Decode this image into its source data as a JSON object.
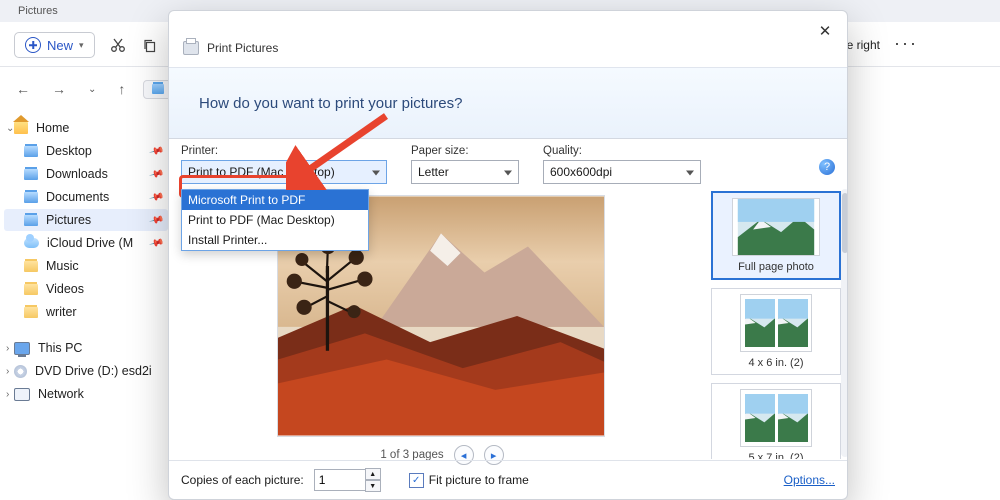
{
  "explorer": {
    "window_title": "Pictures",
    "new_label": "New",
    "right_hint": "e right",
    "address_crumb": "",
    "sidebar": [
      {
        "label": "Home",
        "kind": "home",
        "lv": 0,
        "caret": "v"
      },
      {
        "label": "Desktop",
        "kind": "bluefld",
        "lv": 1,
        "pin": true
      },
      {
        "label": "Downloads",
        "kind": "bluefld",
        "lv": 1,
        "pin": true
      },
      {
        "label": "Documents",
        "kind": "bluefld",
        "lv": 1,
        "pin": true
      },
      {
        "label": "Pictures",
        "kind": "bluefld",
        "lv": 1,
        "pin": true,
        "selected": true
      },
      {
        "label": "iCloud Drive (M",
        "kind": "cloud",
        "lv": 1,
        "pin": true
      },
      {
        "label": "Music",
        "kind": "fld",
        "lv": 1
      },
      {
        "label": "Videos",
        "kind": "fld",
        "lv": 1
      },
      {
        "label": "writer",
        "kind": "fld",
        "lv": 1
      },
      {
        "label": "This PC",
        "kind": "pc",
        "lv": 0,
        "caret": ">",
        "gap": true
      },
      {
        "label": "DVD Drive (D:) esd2i",
        "kind": "dvd",
        "lv": 0,
        "caret": ">"
      },
      {
        "label": "Network",
        "kind": "net",
        "lv": 0,
        "caret": ">"
      }
    ]
  },
  "dialog": {
    "title": "Print Pictures",
    "banner": "How do you want to print your pictures?",
    "labels": {
      "printer": "Printer:",
      "paper": "Paper size:",
      "quality": "Quality:"
    },
    "selected": {
      "printer": "Print to PDF (Mac Desktop)",
      "paper": "Letter",
      "quality": "600x600dpi"
    },
    "printer_options": [
      {
        "label": "Microsoft Print to PDF",
        "highlight": true
      },
      {
        "label": "Print to PDF (Mac Desktop)"
      },
      {
        "label": "Install Printer..."
      }
    ],
    "pager": "1 of 3 pages",
    "layouts": [
      {
        "label": "Full page photo",
        "selected": true,
        "style": "full"
      },
      {
        "label": "4 x 6 in. (2)",
        "style": "two"
      },
      {
        "label": "5 x 7 in. (2)",
        "style": "two"
      }
    ],
    "footer": {
      "copies_label": "Copies of each picture:",
      "copies_value": "1",
      "fit_label": "Fit picture to frame",
      "fit_checked": true,
      "options": "Options..."
    }
  }
}
